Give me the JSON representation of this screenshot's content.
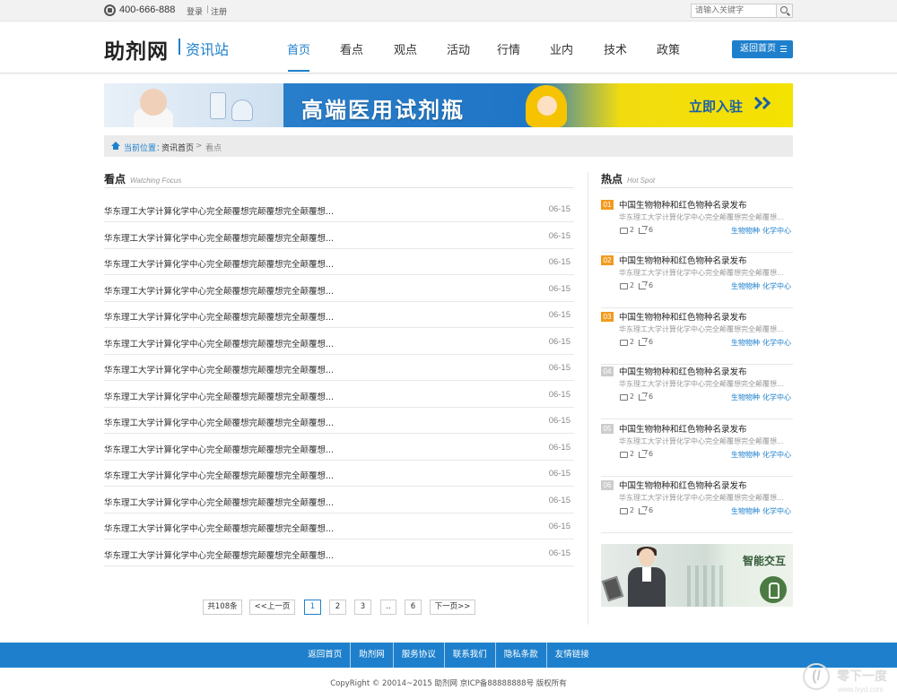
{
  "topbar": {
    "phone": "400-666-888",
    "login": "登录",
    "separator": "|",
    "register": "注册",
    "search_placeholder": "请输入关键字"
  },
  "header": {
    "logo": "助剂网",
    "logo_sub": "资讯站",
    "nav": [
      "首页",
      "看点",
      "观点",
      "活动",
      "行情",
      "业内",
      "技术",
      "政策"
    ],
    "active_nav": "首页",
    "back_button": "返回首页"
  },
  "banner": {
    "title": "高端医用试剂瓶",
    "cta": "立即入驻"
  },
  "breadcrumb": {
    "current_label": "当前位置：",
    "home": "资讯首页",
    "arrow": ">",
    "current": "看点"
  },
  "main": {
    "title": "看点",
    "subtitle": "Watching Focus",
    "items": [
      {
        "title": "华东理工大学计算化学中心完全颠覆想完颠覆想完全颠覆想...",
        "date": "06-15"
      },
      {
        "title": "华东理工大学计算化学中心完全颠覆想完颠覆想完全颠覆想...",
        "date": "06-15"
      },
      {
        "title": "华东理工大学计算化学中心完全颠覆想完颠覆想完全颠覆想...",
        "date": "06-15"
      },
      {
        "title": "华东理工大学计算化学中心完全颠覆想完颠覆想完全颠覆想...",
        "date": "06-15"
      },
      {
        "title": "华东理工大学计算化学中心完全颠覆想完颠覆想完全颠覆想...",
        "date": "06-15"
      },
      {
        "title": "华东理工大学计算化学中心完全颠覆想完颠覆想完全颠覆想...",
        "date": "06-15"
      },
      {
        "title": "华东理工大学计算化学中心完全颠覆想完颠覆想完全颠覆想...",
        "date": "06-15"
      },
      {
        "title": "华东理工大学计算化学中心完全颠覆想完颠覆想完全颠覆想...",
        "date": "06-15"
      },
      {
        "title": "华东理工大学计算化学中心完全颠覆想完颠覆想完全颠覆想...",
        "date": "06-15"
      },
      {
        "title": "华东理工大学计算化学中心完全颠覆想完颠覆想完全颠覆想...",
        "date": "06-15"
      },
      {
        "title": "华东理工大学计算化学中心完全颠覆想完颠覆想完全颠覆想...",
        "date": "06-15"
      },
      {
        "title": "华东理工大学计算化学中心完全颠覆想完颠覆想完全颠覆想...",
        "date": "06-15"
      },
      {
        "title": "华东理工大学计算化学中心完全颠覆想完颠覆想完全颠覆想...",
        "date": "06-15"
      },
      {
        "title": "华东理工大学计算化学中心完全颠覆想完颠覆想完全颠覆想...",
        "date": "06-15"
      }
    ]
  },
  "pagination": {
    "total": "共108条",
    "prev": "<<上一页",
    "pages": [
      "1",
      "2",
      "3"
    ],
    "ellipsis": "..",
    "last": "6",
    "next": "下一页>>",
    "current": "1"
  },
  "hot": {
    "title": "热点",
    "subtitle": "Hot Spot",
    "items": [
      {
        "num": "01",
        "title": "中国生物物种和红色物种名录发布",
        "desc": "华东理工大学计算化学中心完全颠覆想完全颠覆想...",
        "comments": "2",
        "shares": "6",
        "tags": [
          "生物物种",
          "化学中心"
        ],
        "color": "#f39a1e"
      },
      {
        "num": "02",
        "title": "中国生物物种和红色物种名录发布",
        "desc": "华东理工大学计算化学中心完全颠覆想完全颠覆想...",
        "comments": "2",
        "shares": "6",
        "tags": [
          "生物物种",
          "化学中心"
        ],
        "color": "#f39a1e"
      },
      {
        "num": "03",
        "title": "中国生物物种和红色物种名录发布",
        "desc": "华东理工大学计算化学中心完全颠覆想完全颠覆想...",
        "comments": "2",
        "shares": "6",
        "tags": [
          "生物物种",
          "化学中心"
        ],
        "color": "#f39a1e"
      },
      {
        "num": "04",
        "title": "中国生物物种和红色物种名录发布",
        "desc": "华东理工大学计算化学中心完全颠覆想完全颠覆想...",
        "comments": "2",
        "shares": "6",
        "tags": [
          "生物物种",
          "化学中心"
        ],
        "color": "#cccccc"
      },
      {
        "num": "05",
        "title": "中国生物物种和红色物种名录发布",
        "desc": "华东理工大学计算化学中心完全颠覆想完全颠覆想...",
        "comments": "2",
        "shares": "6",
        "tags": [
          "生物物种",
          "化学中心"
        ],
        "color": "#cccccc"
      },
      {
        "num": "06",
        "title": "中国生物物种和红色物种名录发布",
        "desc": "华东理工大学计算化学中心完全颠覆想完全颠覆想...",
        "comments": "2",
        "shares": "6",
        "tags": [
          "生物物种",
          "化学中心"
        ],
        "color": "#cccccc"
      }
    ]
  },
  "ad": {
    "text": "智能交互"
  },
  "footer": {
    "links": [
      "返回首页",
      "助剂网",
      "服务协议",
      "联系我们",
      "隐私条款",
      "友情链接"
    ],
    "copyright": "CopyRight © 20014~2015 助剂网 京ICP备88888888号 版权所有"
  },
  "watermark": {
    "name": "零下一度",
    "url": "www.lxyd.com"
  },
  "colors": {
    "accent": "#1e80cc",
    "hot_top": "#f39a1e",
    "hot_rest": "#cccccc"
  }
}
